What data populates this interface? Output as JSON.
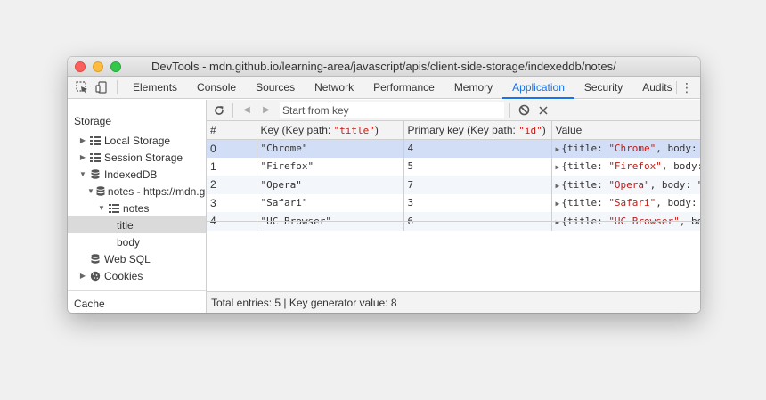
{
  "window": {
    "title": "DevTools - mdn.github.io/learning-area/javascript/apis/client-side-storage/indexeddb/notes/"
  },
  "tabs": [
    {
      "label": "Elements"
    },
    {
      "label": "Console"
    },
    {
      "label": "Sources"
    },
    {
      "label": "Network"
    },
    {
      "label": "Performance"
    },
    {
      "label": "Memory"
    },
    {
      "label": "Application",
      "active": true
    },
    {
      "label": "Security"
    },
    {
      "label": "Audits"
    }
  ],
  "sidebar": {
    "storage_header": "Storage",
    "cache_header": "Cache",
    "items": [
      {
        "label": "Local Storage"
      },
      {
        "label": "Session Storage"
      },
      {
        "label": "IndexedDB"
      },
      {
        "label": "notes - https://mdn.github.io"
      },
      {
        "label": "notes"
      },
      {
        "label": "title"
      },
      {
        "label": "body"
      },
      {
        "label": "Web SQL"
      },
      {
        "label": "Cookies"
      }
    ]
  },
  "toolbar": {
    "search_placeholder": "Start from key"
  },
  "table": {
    "headers": {
      "index": "#",
      "key_prefix": "Key (Key path: ",
      "key_path": "\"title\"",
      "key_suffix": ")",
      "pk_prefix": "Primary key (Key path: ",
      "pk_path": "\"id\"",
      "pk_suffix": ")",
      "value": "Value"
    },
    "rows": [
      {
        "index": "0",
        "key": "\"Chrome\"",
        "primary": "4",
        "value_prefix": "{title: ",
        "value_title": "\"Chrome\"",
        "value_suffix": ", body: \""
      },
      {
        "index": "1",
        "key": "\"Firefox\"",
        "primary": "5",
        "value_prefix": "{title: ",
        "value_title": "\"Firefox\"",
        "value_suffix": ", body: \""
      },
      {
        "index": "2",
        "key": "\"Opera\"",
        "primary": "7",
        "value_prefix": "{title: ",
        "value_title": "\"Opera\"",
        "value_suffix": ", body: \""
      },
      {
        "index": "3",
        "key": "\"Safari\"",
        "primary": "3",
        "value_prefix": "{title: ",
        "value_title": "\"Safari\"",
        "value_suffix": ", body: \""
      },
      {
        "index": "4",
        "key": "\"UC Browser\"",
        "primary": "6",
        "value_prefix": "{title: ",
        "value_title": "\"UC Browser\"",
        "value_suffix": ", body: \""
      }
    ]
  },
  "footer": {
    "text": "Total entries: 5 | Key generator value: 8"
  },
  "colors": {
    "accent": "#1a73e8",
    "string": "#c41a16",
    "number": "#1c00cf",
    "selected_row": "#d2def6"
  }
}
